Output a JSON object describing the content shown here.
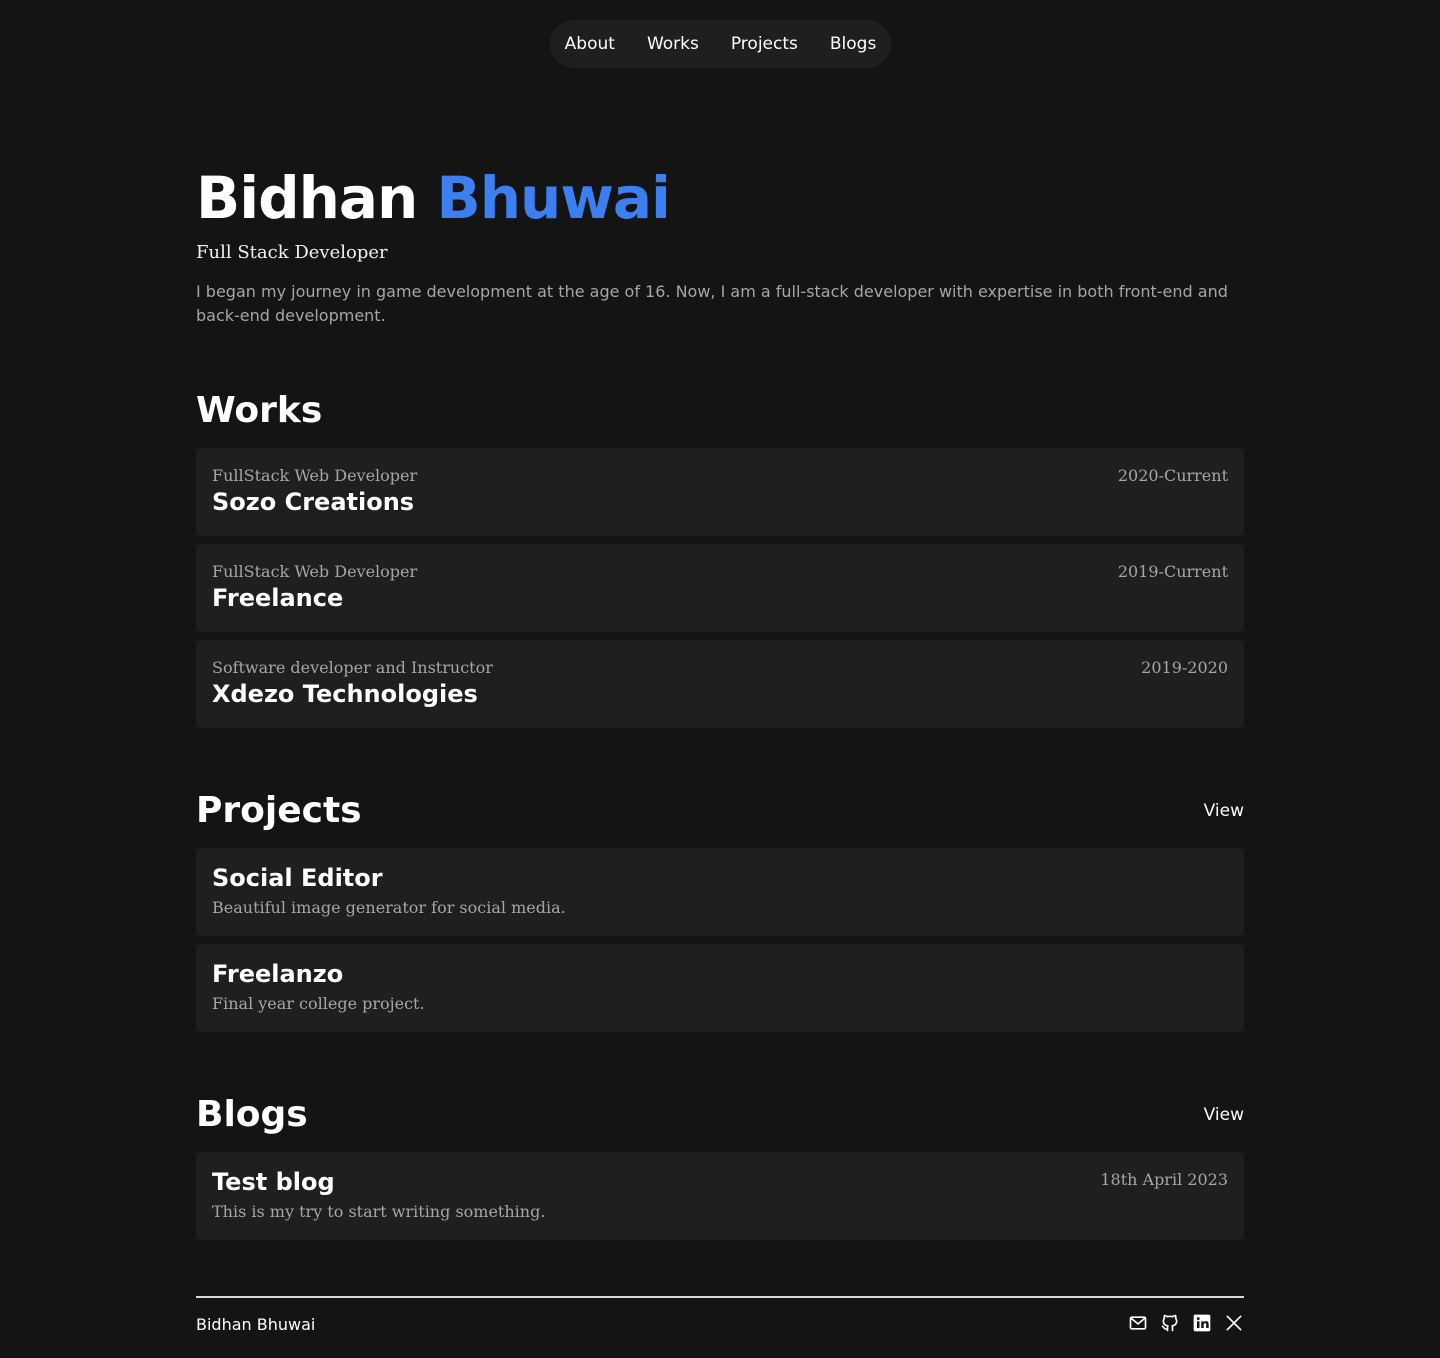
{
  "nav": {
    "items": [
      {
        "label": "About"
      },
      {
        "label": "Works"
      },
      {
        "label": "Projects"
      },
      {
        "label": "Blogs"
      }
    ]
  },
  "hero": {
    "first_name": "Bidhan",
    "last_name": "Bhuwai",
    "role": "Full Stack Developer",
    "bio": "I began my journey in game development at the age of 16. Now, I am a full-stack developer with expertise in both front-end and back-end development."
  },
  "works": {
    "title": "Works",
    "items": [
      {
        "role": "FullStack Web Developer",
        "company": "Sozo Creations",
        "period": "2020-Current"
      },
      {
        "role": "FullStack Web Developer",
        "company": "Freelance",
        "period": "2019-Current"
      },
      {
        "role": "Software developer and Instructor",
        "company": "Xdezo Technologies",
        "period": "2019-2020"
      }
    ]
  },
  "projects": {
    "title": "Projects",
    "view_label": "View",
    "items": [
      {
        "name": "Social Editor",
        "description": "Beautiful image generator for social media."
      },
      {
        "name": "Freelanzo",
        "description": "Final year college project."
      }
    ]
  },
  "blogs": {
    "title": "Blogs",
    "view_label": "View",
    "items": [
      {
        "title": "Test blog",
        "excerpt": "This is my try to start writing something.",
        "date": "18th April 2023"
      }
    ]
  },
  "footer": {
    "name": "Bidhan Bhuwai",
    "icons": [
      "mail-icon",
      "github-icon",
      "linkedin-icon",
      "x-icon"
    ]
  },
  "colors": {
    "background": "#141414",
    "card": "#1f1f1f",
    "accent": "#3b7ff0",
    "muted": "#a6a6a6"
  }
}
